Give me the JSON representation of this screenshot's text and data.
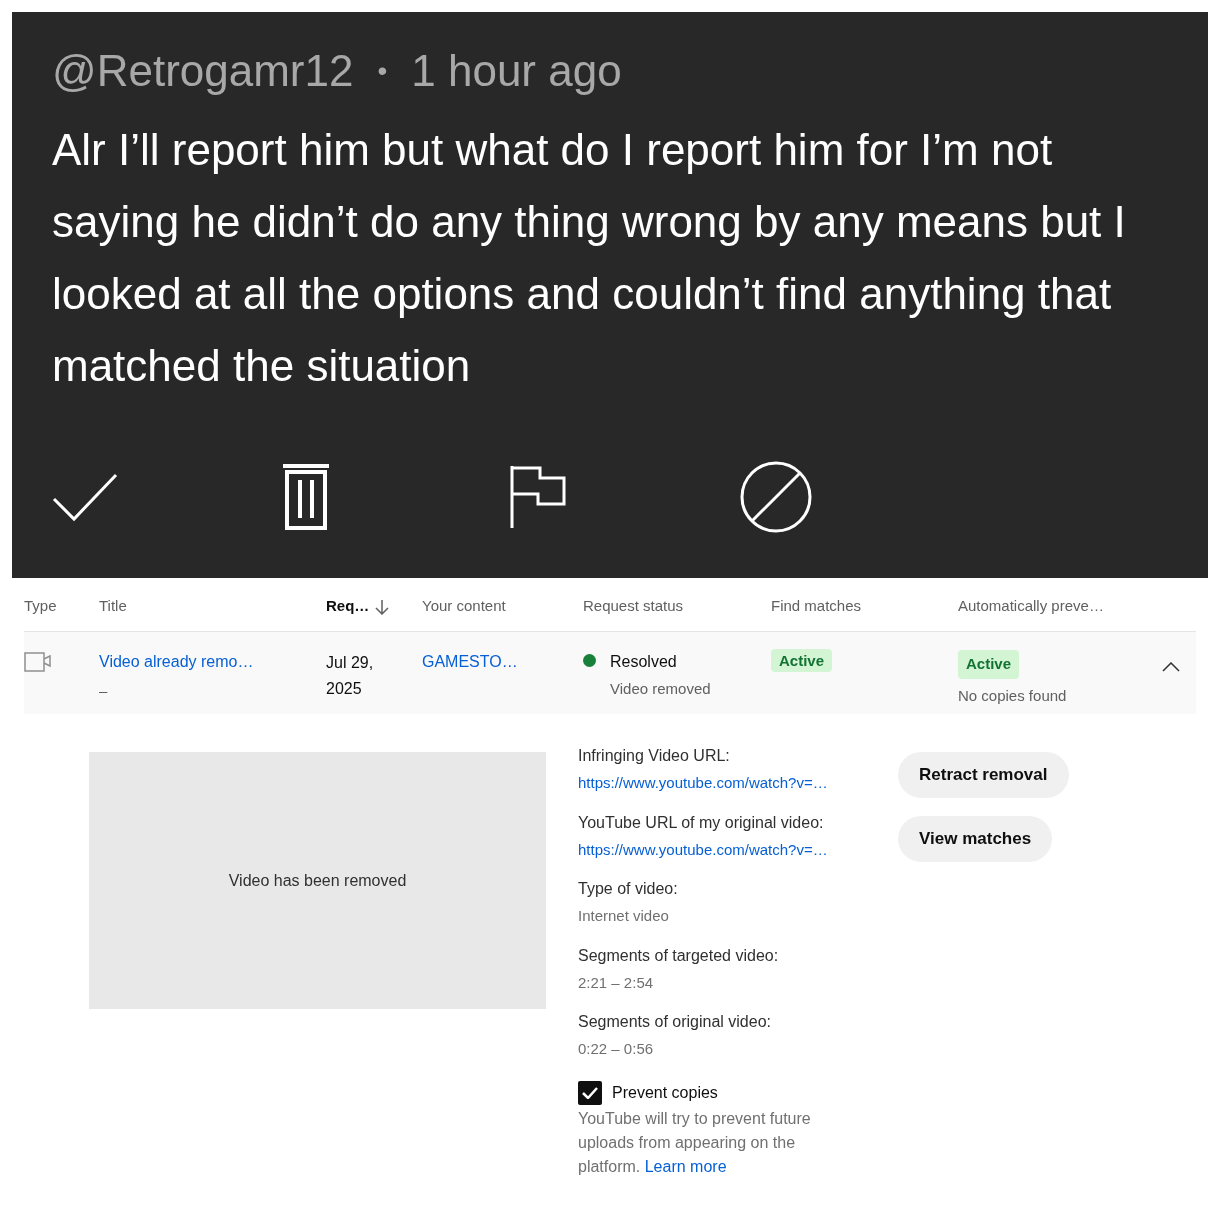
{
  "comment": {
    "author": "@Retrogamr12",
    "separator": "•",
    "time": "1 hour ago",
    "text": "Alr I’ll report him but what do I report him for I’m not saying he didn’t do any thing wrong by any means but I looked at all the options and couldn’t find anything that matched the situation",
    "actions": [
      {
        "kind": "approve"
      },
      {
        "kind": "remove"
      },
      {
        "kind": "report"
      },
      {
        "kind": "block"
      }
    ]
  },
  "table": {
    "columns": [
      {
        "label": "Type",
        "sorted": false
      },
      {
        "label": "Title",
        "sorted": false
      },
      {
        "label": "Req…",
        "sorted": true
      },
      {
        "label": "Your content",
        "sorted": false
      },
      {
        "label": "Request status",
        "sorted": false
      },
      {
        "label": "Find matches",
        "sorted": false
      },
      {
        "label": "Automatically preve…",
        "sorted": false
      }
    ],
    "row": {
      "title": "Video already remo…",
      "subtitle": "–",
      "date": "Jul 29, 2025",
      "content": "GAMESTO…",
      "status": "Resolved",
      "status_detail": "Video removed",
      "find_matches": "Active",
      "auto_prevent": "Active",
      "auto_prevent_detail": "No copies found",
      "expanded": true
    }
  },
  "details": {
    "preview": "Video has been removed",
    "fields": [
      {
        "label": "Infringing Video URL:",
        "value": "https://www.youtube.com/watch?v=…",
        "kind": "link"
      },
      {
        "label": "YouTube URL of my original video:",
        "value": "https://www.youtube.com/watch?v=…",
        "kind": "link"
      },
      {
        "label": "Type of video:",
        "value": "Internet video",
        "kind": "text"
      },
      {
        "label": "Segments of targeted video:",
        "value": "2:21 – 2:54",
        "kind": "text"
      },
      {
        "label": "Segments of original video:",
        "value": "0:22 – 0:56",
        "kind": "text"
      }
    ],
    "prevent_copies": {
      "label": "Prevent copies",
      "checked": true,
      "description": "YouTube will try to prevent future uploads from appearing on the platform.",
      "link": "Learn more"
    },
    "buttons": [
      "Retract removal",
      "View matches"
    ]
  }
}
